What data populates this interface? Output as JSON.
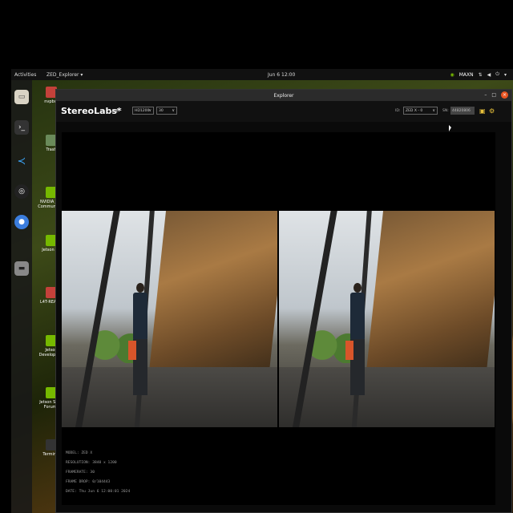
{
  "topbar": {
    "activities": "Activities",
    "app_menu": "ZED_Explorer ▾",
    "clock": "Jun 6 12:00",
    "tray_label": "MAXN"
  },
  "dock": {
    "items": [
      {
        "icon": "files-icon"
      },
      {
        "icon": "terminal-icon"
      },
      {
        "icon": "vscode-icon"
      },
      {
        "icon": "obs-icon"
      },
      {
        "icon": "chromium-icon"
      },
      {
        "icon": "disk-icon"
      }
    ]
  },
  "desktop_icons": [
    {
      "label": "nvpbot",
      "icon": "folder-icon"
    },
    {
      "label": "Trash",
      "icon": "trash-icon"
    },
    {
      "label": "NVIDIA Jetson Community Projects",
      "short": "NVIDIA Jets Community P",
      "icon": "nvidia-icon"
    },
    {
      "label": "Jetson Zoo",
      "short": "Jetson Zo",
      "icon": "nvidia-icon"
    },
    {
      "label": "L4T-README",
      "short": "L4T-READN",
      "icon": "folder-icon"
    },
    {
      "label": "Jetson Developer Zone",
      "short": "Jetson Developer Z",
      "icon": "nvidia-icon"
    },
    {
      "label": "Jetson Support Forums",
      "short": "Jetson Supp Forums",
      "icon": "nvidia-icon"
    },
    {
      "label": "Terminal",
      "short": "Terminal",
      "icon": "terminal-icon"
    }
  ],
  "window": {
    "title": "Explorer",
    "minimize": "–",
    "maximize": "□",
    "close": "×"
  },
  "toolbar": {
    "logo": "StereoLabs*",
    "live": "LIVE",
    "resolution": "HD1200",
    "fps": "30",
    "id_label": "ID:",
    "camera_select": "ZED X - 0",
    "sn_label": "SN:",
    "serial": "44820806"
  },
  "info": {
    "model": "MODEL: ZED X",
    "resolution": "RESOLUTION: 3840 x 1200",
    "framerate": "FRAMERATE: 30",
    "frame_drop": "FRAME DROP: 0/104443",
    "date": "DATE: Thu Jun 6 12:00:01 2024"
  }
}
